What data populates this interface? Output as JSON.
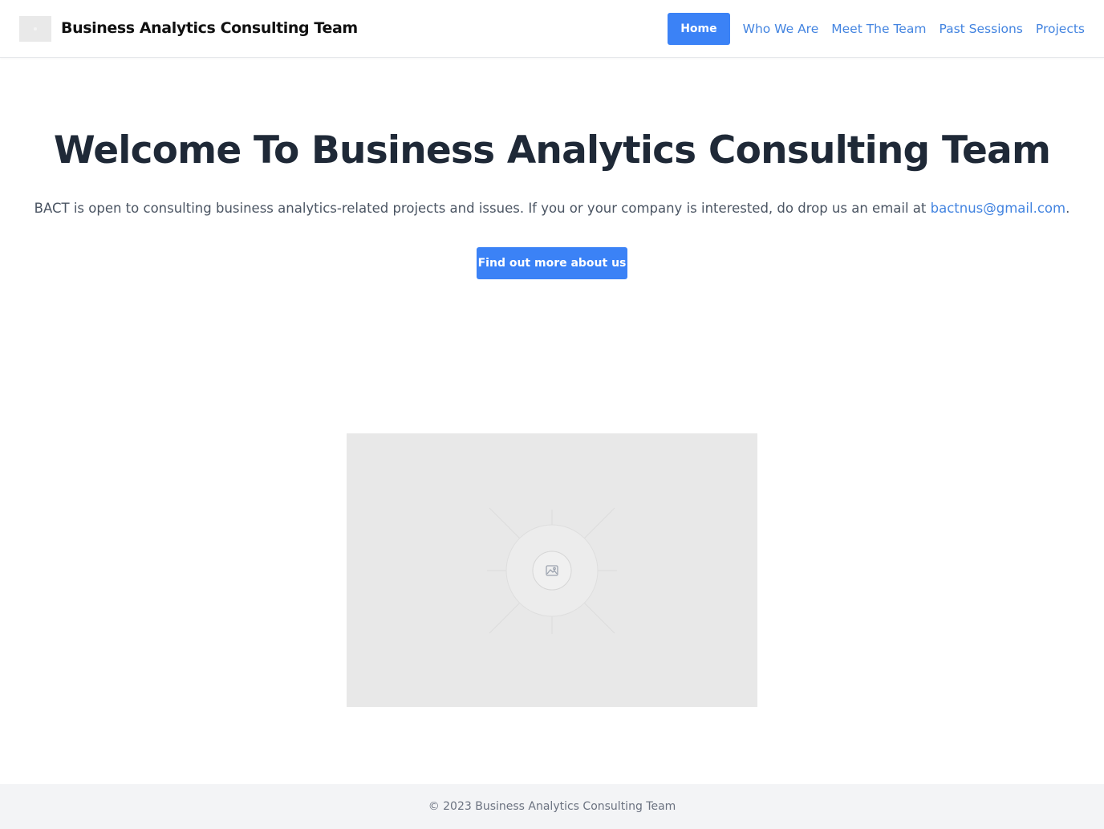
{
  "header": {
    "brand": "Business Analytics Consulting Team",
    "nav": {
      "home": "Home",
      "who_we_are": "Who We Are",
      "meet_the_team": "Meet The Team",
      "past_sessions": "Past Sessions",
      "projects": "Projects"
    }
  },
  "hero": {
    "title": "Welcome To Business Analytics Consulting Team",
    "description": "BACT is open to consulting business analytics-related projects and issues. If you or your company is interested, do drop us an email at ",
    "email": "bactnus@gmail.com",
    "description_end": ".",
    "cta_label": "Find out more about us"
  },
  "footer": {
    "copyright": "© 2023 Business Analytics Consulting Team"
  },
  "colors": {
    "primary": "#3b82f6",
    "link": "#4384e0",
    "heading": "#1f2937",
    "body_text": "#4b5563",
    "footer_bg": "#f3f4f6",
    "placeholder_bg": "#e8e8e8"
  },
  "icons": {
    "logo": "logo-placeholder-icon",
    "hero_image": "image-icon"
  }
}
